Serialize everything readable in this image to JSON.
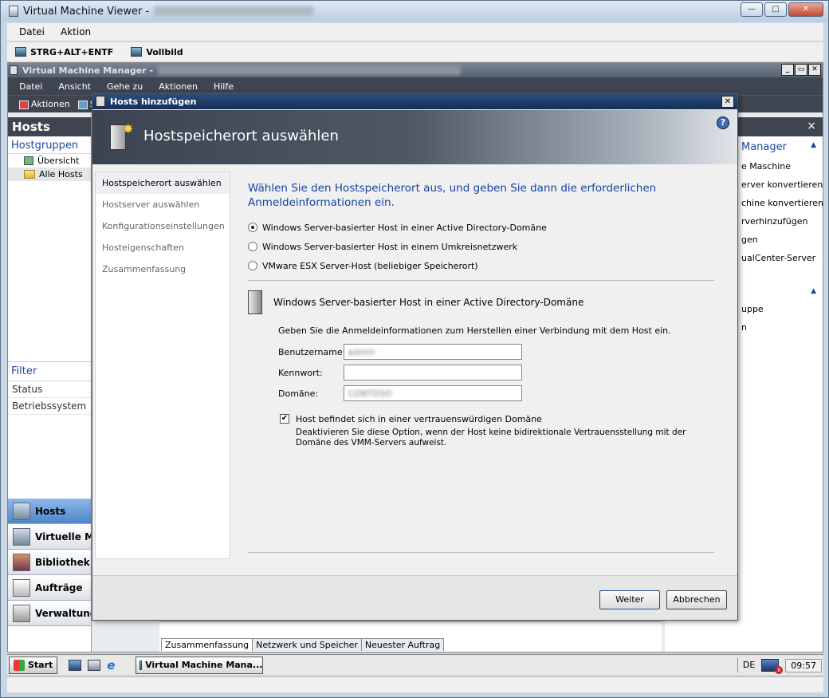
{
  "viewer": {
    "title": "Virtual Machine Viewer -",
    "menu": [
      "Datei",
      "Aktion"
    ],
    "toolbar": {
      "ctrl_alt_del": "STRG+ALT+ENTF",
      "fullscreen": "Vollbild"
    }
  },
  "vmm": {
    "title": "Virtual Machine Manager -",
    "menu": [
      "Datei",
      "Ansicht",
      "Gehe zu",
      "Aktionen",
      "Hilfe"
    ],
    "toolbar": {
      "actions": "Aktionen",
      "s": "S"
    },
    "left": {
      "header": "Hosts",
      "subheader": "Hostgruppen",
      "tree": [
        "Übersicht",
        "Alle Hosts"
      ],
      "filter": {
        "header": "Filter",
        "items": [
          "Status",
          "Betriebssystem"
        ]
      },
      "nav": [
        "Hosts",
        "Virtuelle Ma",
        "Bibliothek",
        "Aufträge",
        "Verwaltung"
      ]
    },
    "right": {
      "close": "×",
      "section1": "Manager",
      "items1": [
        "e Maschine",
        "erver konvertieren",
        "chine konvertieren",
        "rverhinzufügen",
        "gen",
        "ualCenter-Server"
      ],
      "items2": [
        "uppe",
        "n"
      ]
    },
    "tabs": [
      "Zusammenfassung",
      "Netzwerk und Speicher",
      "Neuester Auftrag"
    ]
  },
  "taskbar": {
    "start": "Start",
    "task": "Virtual Machine Mana...",
    "lang": "DE",
    "clock": "09:57"
  },
  "dialog": {
    "title": "Hosts hinzufügen",
    "banner_title": "Hostspeicherort auswählen",
    "help": "?",
    "steps": [
      "Hostspeicherort auswählen",
      "Hostserver auswählen",
      "Konfigurationseinstellungen",
      "Hosteigenschaften",
      "Zusammenfassung"
    ],
    "instruction": "Wählen Sie den Hostspeicherort aus, und geben Sie dann die erforderlichen Anmeldeinformationen ein.",
    "radios": [
      "Windows Server-basierter Host in einer Active Directory-Domäne",
      "Windows Server-basierter Host in einem Umkreisnetzwerk",
      "VMware ESX Server-Host (beliebiger Speicherort)"
    ],
    "section_title": "Windows Server-basierter Host in einer Active Directory-Domäne",
    "section_desc": "Geben Sie die Anmeldeinformationen zum Herstellen einer Verbindung mit dem Host ein.",
    "fields": {
      "username_label": "Benutzername:",
      "username_value": "admin",
      "password_label": "Kennwort:",
      "password_value": "",
      "domain_label": "Domäne:",
      "domain_value": "CONTOSO"
    },
    "trusted_label": "Host befindet sich in einer vertrauenswürdigen Domäne",
    "trusted_desc": "Deaktivieren Sie diese Option, wenn der Host keine bidirektionale Vertrauensstellung mit der Domäne des VMM-Servers aufweist.",
    "buttons": {
      "next": "Weiter",
      "cancel": "Abbrechen"
    }
  }
}
